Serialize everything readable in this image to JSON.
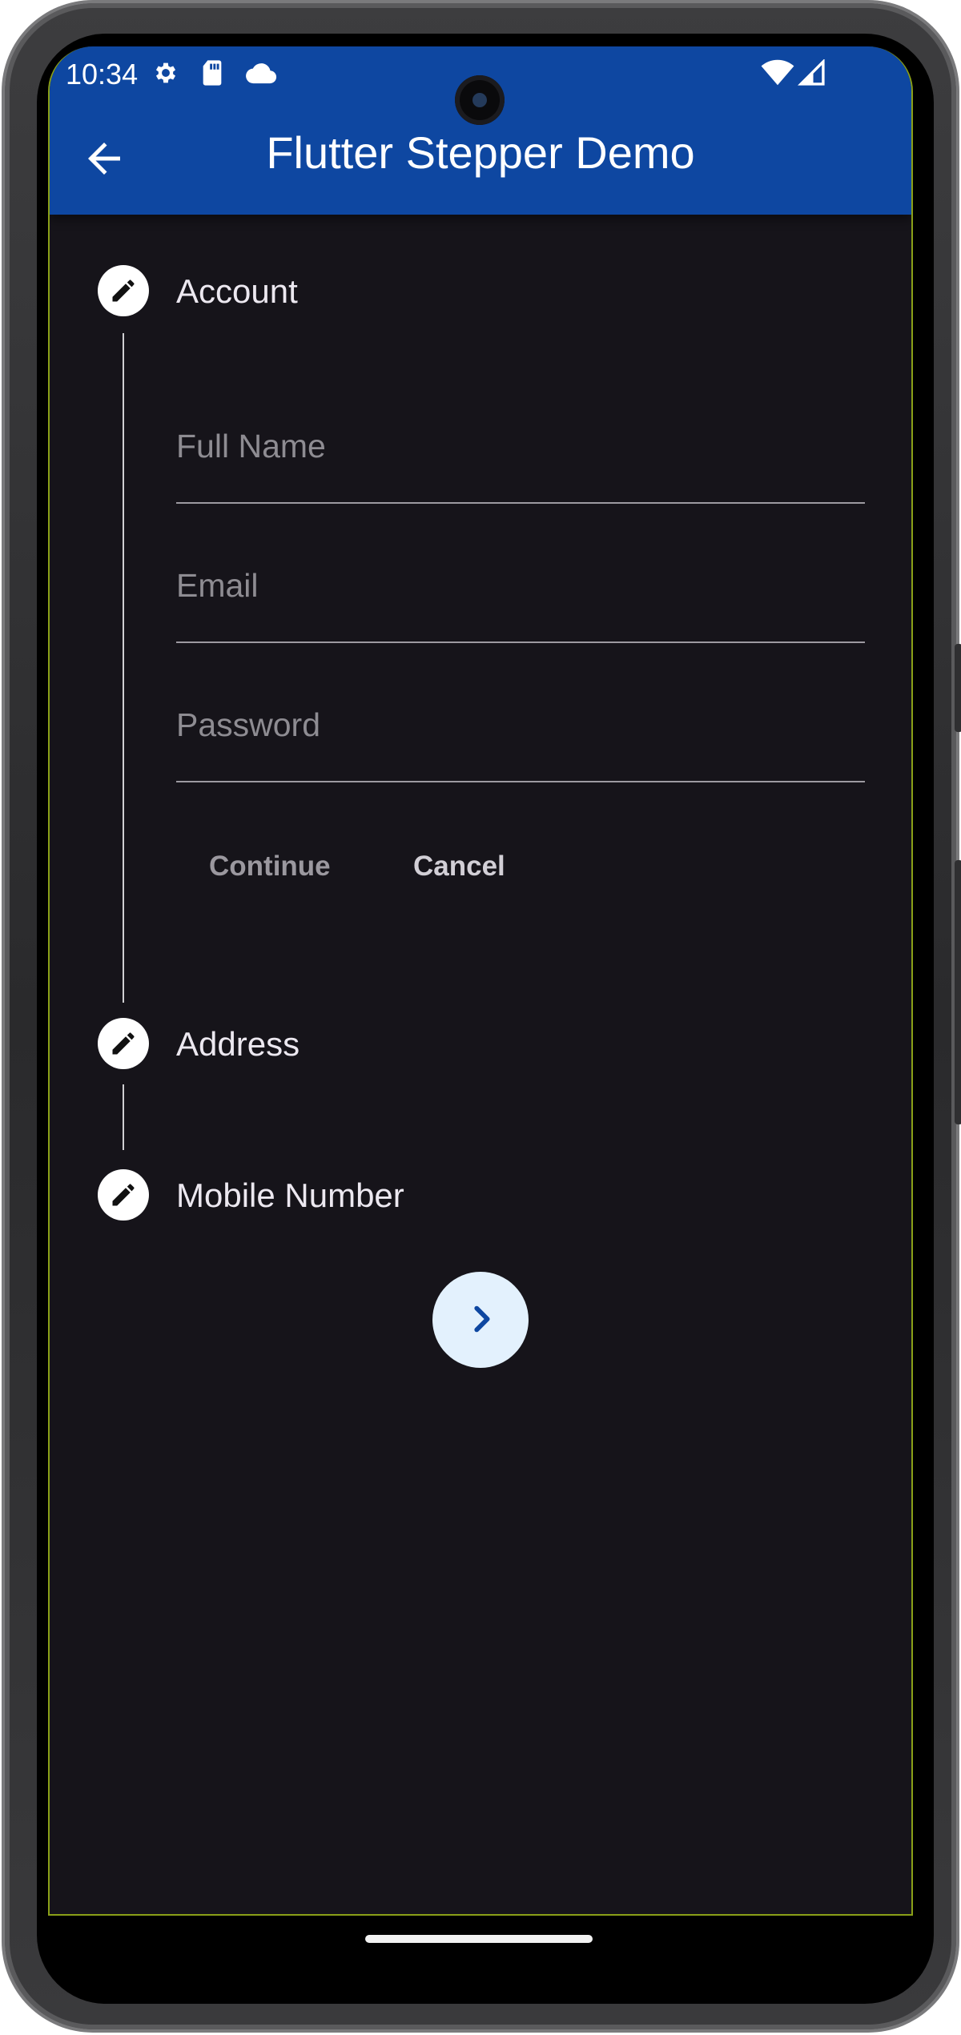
{
  "status_bar": {
    "time": "10:34",
    "left_icons": [
      "gear-icon",
      "sd-card-icon",
      "cloud-icon"
    ],
    "right_icons": [
      "wifi-icon",
      "signal-icon"
    ]
  },
  "app_bar": {
    "title": "Flutter Stepper Demo",
    "back_icon": "arrow-back-icon",
    "color": "#0e47a1"
  },
  "stepper": {
    "steps": [
      {
        "title": "Account",
        "icon": "pencil-edit-icon",
        "active": true
      },
      {
        "title": "Address",
        "icon": "pencil-edit-icon",
        "active": false
      },
      {
        "title": "Mobile Number",
        "icon": "pencil-edit-icon",
        "active": false
      }
    ],
    "account_fields": [
      {
        "label": "Full Name",
        "value": ""
      },
      {
        "label": "Email",
        "value": ""
      },
      {
        "label": "Password",
        "value": ""
      }
    ],
    "controls": {
      "continue_label": "Continue",
      "cancel_label": "Cancel"
    }
  },
  "fab": {
    "icon": "chevron-right-icon",
    "color": "#e3f1fd",
    "icon_color": "#0e47a1"
  },
  "theme": {
    "background": "#16141a",
    "text": "#ece8f0",
    "hint": "#8e8c92"
  }
}
